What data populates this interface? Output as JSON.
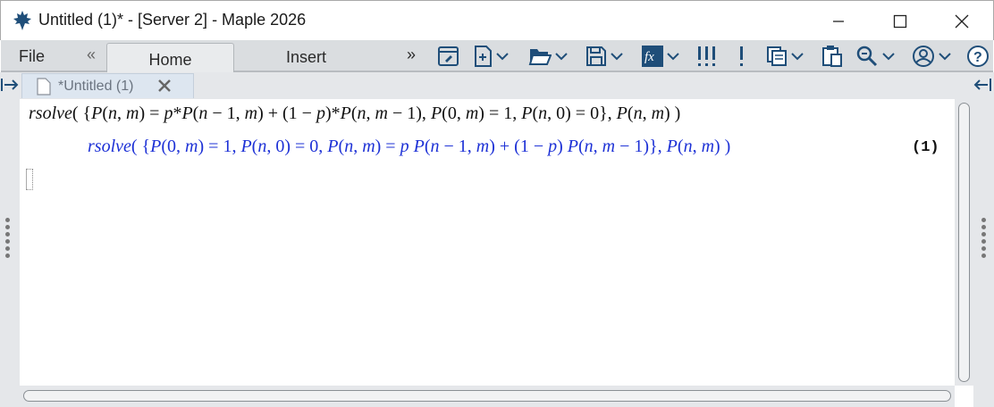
{
  "window": {
    "title": "Untitled (1)* - [Server 2] - Maple 2026",
    "app_icon": "maple-leaf-icon"
  },
  "menu": {
    "file": "File",
    "nav_left": "«",
    "nav_right": "»",
    "tabs": [
      {
        "label": "Home",
        "active": true
      },
      {
        "label": "Insert",
        "active": false
      }
    ]
  },
  "toolbar_icons": [
    "new-worksheet-icon",
    "new-document-icon",
    "open-folder-icon",
    "save-icon",
    "text-math-toggle-icon",
    "execute-all-icon",
    "execute-icon",
    "copy-icon",
    "paste-icon",
    "find-icon",
    "account-icon",
    "help-icon"
  ],
  "document_tab": {
    "label": "*Untitled (1)"
  },
  "worksheet": {
    "input": "rsolve({P(n,m) = p*P(n − 1,m) + (1 − p)*P(n,m − 1), P(0,m) = 1, P(n,0) = 0}, P(n,m))",
    "output": "rsolve({P(0, m) = 1, P(n, 0) = 0, P(n, m) = p P(n − 1, m) + (1 − p) P(n, m − 1)}, P(n, m))",
    "equation_label": "(1)"
  },
  "colors": {
    "output_text": "#1d31d6",
    "toolbar_bg": "#dadde0",
    "icon_blue": "#1f4e79"
  }
}
